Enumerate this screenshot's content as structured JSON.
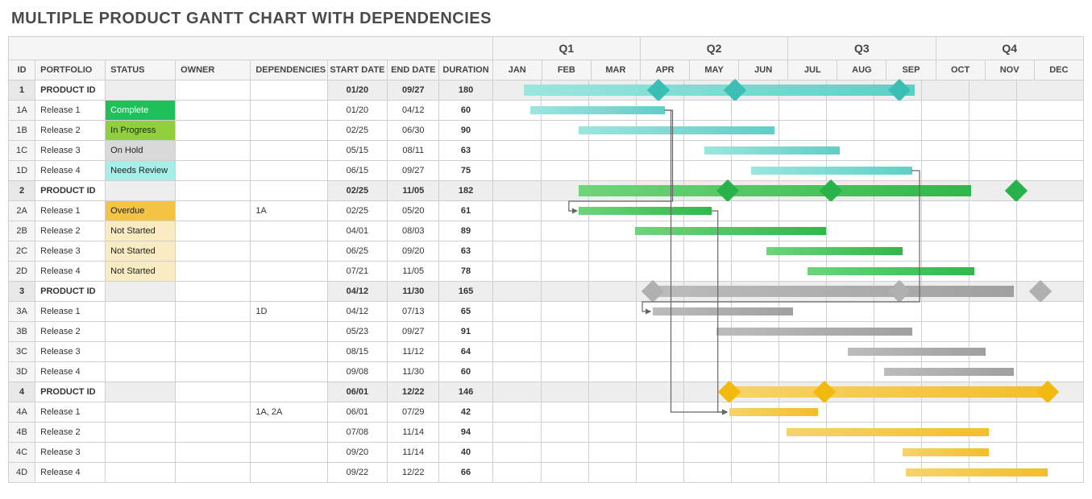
{
  "title": "MULTIPLE PRODUCT GANTT CHART WITH DEPENDENCIES",
  "headers": {
    "id": "ID",
    "portfolio": "PORTFOLIO",
    "status": "STATUS",
    "owner": "OWNER",
    "deps": "DEPENDENCIES",
    "start": "START DATE",
    "end": "END DATE",
    "duration": "DURATION"
  },
  "quarters": [
    "Q1",
    "Q2",
    "Q3",
    "Q4"
  ],
  "months": [
    "JAN",
    "FEB",
    "MAR",
    "APR",
    "MAY",
    "JUN",
    "JUL",
    "AUG",
    "SEP",
    "OCT",
    "NOV",
    "DEC"
  ],
  "status_labels": {
    "complete": "Complete",
    "inprog": "In Progress",
    "onhold": "On Hold",
    "review": "Needs Review",
    "overdue": "Overdue",
    "notstart": "Not Started"
  },
  "rows": [
    {
      "id": "1",
      "product": true,
      "portfolio": "PRODUCT ID",
      "status": "",
      "owner": "",
      "deps": "",
      "start": "01/20",
      "end": "09/27",
      "duration": "180",
      "color": "teal",
      "barStart": 20,
      "barEnd": 270,
      "milestones": [
        106,
        155,
        260
      ]
    },
    {
      "id": "1A",
      "portfolio": "Release 1",
      "status": "complete",
      "owner": "",
      "deps": "",
      "start": "01/20",
      "end": "04/12",
      "duration": "60",
      "color": "teal",
      "barStart": 24,
      "barEnd": 110
    },
    {
      "id": "1B",
      "portfolio": "Release 2",
      "status": "inprog",
      "owner": "",
      "deps": "",
      "start": "02/25",
      "end": "06/30",
      "duration": "90",
      "color": "teal",
      "barStart": 55,
      "barEnd": 180
    },
    {
      "id": "1C",
      "portfolio": "Release 3",
      "status": "onhold",
      "owner": "",
      "deps": "",
      "start": "05/15",
      "end": "08/11",
      "duration": "63",
      "color": "teal",
      "barStart": 135,
      "barEnd": 222
    },
    {
      "id": "1D",
      "portfolio": "Release 4",
      "status": "review",
      "owner": "",
      "deps": "",
      "start": "06/15",
      "end": "09/27",
      "duration": "75",
      "color": "teal",
      "barStart": 165,
      "barEnd": 268
    },
    {
      "id": "2",
      "product": true,
      "portfolio": "PRODUCT ID",
      "status": "",
      "owner": "",
      "deps": "",
      "start": "02/25",
      "end": "11/05",
      "duration": "182",
      "color": "green",
      "barStart": 55,
      "barEnd": 306,
      "milestones": [
        150,
        216,
        335
      ]
    },
    {
      "id": "2A",
      "portfolio": "Release 1",
      "status": "overdue",
      "owner": "",
      "deps": "1A",
      "start": "02/25",
      "end": "05/20",
      "duration": "61",
      "color": "green",
      "barStart": 55,
      "barEnd": 140
    },
    {
      "id": "2B",
      "portfolio": "Release 2",
      "status": "notstart",
      "owner": "",
      "deps": "",
      "start": "04/01",
      "end": "08/03",
      "duration": "89",
      "color": "green",
      "barStart": 91,
      "barEnd": 213
    },
    {
      "id": "2C",
      "portfolio": "Release 3",
      "status": "notstart",
      "owner": "",
      "deps": "",
      "start": "06/25",
      "end": "09/20",
      "duration": "63",
      "color": "green",
      "barStart": 175,
      "barEnd": 262
    },
    {
      "id": "2D",
      "portfolio": "Release 4",
      "status": "notstart",
      "owner": "",
      "deps": "",
      "start": "07/21",
      "end": "11/05",
      "duration": "78",
      "color": "green",
      "barStart": 201,
      "barEnd": 308
    },
    {
      "id": "3",
      "product": true,
      "portfolio": "PRODUCT ID",
      "status": "",
      "owner": "",
      "deps": "",
      "start": "04/12",
      "end": "11/30",
      "duration": "165",
      "color": "grey",
      "barStart": 102,
      "barEnd": 333,
      "milestones": [
        102,
        260,
        350
      ]
    },
    {
      "id": "3A",
      "portfolio": "Release 1",
      "status": "",
      "owner": "",
      "deps": "1D",
      "start": "04/12",
      "end": "07/13",
      "duration": "65",
      "color": "grey",
      "barStart": 102,
      "barEnd": 192
    },
    {
      "id": "3B",
      "portfolio": "Release 2",
      "status": "",
      "owner": "",
      "deps": "",
      "start": "05/23",
      "end": "09/27",
      "duration": "91",
      "color": "grey",
      "barStart": 143,
      "barEnd": 268
    },
    {
      "id": "3C",
      "portfolio": "Release 3",
      "status": "",
      "owner": "",
      "deps": "",
      "start": "08/15",
      "end": "11/12",
      "duration": "64",
      "color": "grey",
      "barStart": 227,
      "barEnd": 315
    },
    {
      "id": "3D",
      "portfolio": "Release 4",
      "status": "",
      "owner": "",
      "deps": "",
      "start": "09/08",
      "end": "11/30",
      "duration": "60",
      "color": "grey",
      "barStart": 250,
      "barEnd": 333
    },
    {
      "id": "4",
      "product": true,
      "portfolio": "PRODUCT ID",
      "status": "",
      "owner": "",
      "deps": "",
      "start": "06/01",
      "end": "12/22",
      "duration": "146",
      "color": "gold",
      "barStart": 151,
      "barEnd": 355,
      "milestones": [
        151,
        212,
        355
      ]
    },
    {
      "id": "4A",
      "portfolio": "Release 1",
      "status": "",
      "owner": "",
      "deps": "1A, 2A",
      "start": "06/01",
      "end": "07/29",
      "duration": "42",
      "color": "gold",
      "barStart": 151,
      "barEnd": 208
    },
    {
      "id": "4B",
      "portfolio": "Release 2",
      "status": "",
      "owner": "",
      "deps": "",
      "start": "07/08",
      "end": "11/14",
      "duration": "94",
      "color": "gold",
      "barStart": 188,
      "barEnd": 317
    },
    {
      "id": "4C",
      "portfolio": "Release 3",
      "status": "",
      "owner": "",
      "deps": "",
      "start": "09/20",
      "end": "11/14",
      "duration": "40",
      "color": "gold",
      "barStart": 262,
      "barEnd": 317
    },
    {
      "id": "4D",
      "portfolio": "Release 4",
      "status": "",
      "owner": "",
      "deps": "",
      "start": "09/22",
      "end": "12/22",
      "duration": "66",
      "color": "gold",
      "barStart": 264,
      "barEnd": 355
    }
  ],
  "dep_arrows": [
    {
      "from": "1A",
      "to": "2A"
    },
    {
      "from": "1D",
      "to": "3A"
    },
    {
      "from": "1A",
      "to": "4A"
    },
    {
      "from": "2A",
      "to": "4A"
    }
  ],
  "chart_data": {
    "type": "gantt",
    "title": "MULTIPLE PRODUCT GANTT CHART WITH DEPENDENCIES",
    "x_axis": {
      "months": [
        "JAN",
        "FEB",
        "MAR",
        "APR",
        "MAY",
        "JUN",
        "JUL",
        "AUG",
        "SEP",
        "OCT",
        "NOV",
        "DEC"
      ],
      "quarters": [
        "Q1",
        "Q2",
        "Q3",
        "Q4"
      ]
    },
    "products": [
      {
        "id": "1",
        "name": "PRODUCT ID",
        "start": "01/20",
        "end": "09/27",
        "duration": 180,
        "color": "teal",
        "tasks": [
          {
            "id": "1A",
            "name": "Release 1",
            "status": "Complete",
            "start": "01/20",
            "end": "04/12",
            "duration": 60
          },
          {
            "id": "1B",
            "name": "Release 2",
            "status": "In Progress",
            "start": "02/25",
            "end": "06/30",
            "duration": 90
          },
          {
            "id": "1C",
            "name": "Release 3",
            "status": "On Hold",
            "start": "05/15",
            "end": "08/11",
            "duration": 63
          },
          {
            "id": "1D",
            "name": "Release 4",
            "status": "Needs Review",
            "start": "06/15",
            "end": "09/27",
            "duration": 75
          }
        ]
      },
      {
        "id": "2",
        "name": "PRODUCT ID",
        "start": "02/25",
        "end": "11/05",
        "duration": 182,
        "color": "green",
        "tasks": [
          {
            "id": "2A",
            "name": "Release 1",
            "status": "Overdue",
            "deps": "1A",
            "start": "02/25",
            "end": "05/20",
            "duration": 61
          },
          {
            "id": "2B",
            "name": "Release 2",
            "status": "Not Started",
            "start": "04/01",
            "end": "08/03",
            "duration": 89
          },
          {
            "id": "2C",
            "name": "Release 3",
            "status": "Not Started",
            "start": "06/25",
            "end": "09/20",
            "duration": 63
          },
          {
            "id": "2D",
            "name": "Release 4",
            "status": "Not Started",
            "start": "07/21",
            "end": "11/05",
            "duration": 78
          }
        ]
      },
      {
        "id": "3",
        "name": "PRODUCT ID",
        "start": "04/12",
        "end": "11/30",
        "duration": 165,
        "color": "grey",
        "tasks": [
          {
            "id": "3A",
            "name": "Release 1",
            "deps": "1D",
            "start": "04/12",
            "end": "07/13",
            "duration": 65
          },
          {
            "id": "3B",
            "name": "Release 2",
            "start": "05/23",
            "end": "09/27",
            "duration": 91
          },
          {
            "id": "3C",
            "name": "Release 3",
            "start": "08/15",
            "end": "11/12",
            "duration": 64
          },
          {
            "id": "3D",
            "name": "Release 4",
            "start": "09/08",
            "end": "11/30",
            "duration": 60
          }
        ]
      },
      {
        "id": "4",
        "name": "PRODUCT ID",
        "start": "06/01",
        "end": "12/22",
        "duration": 146,
        "color": "gold",
        "tasks": [
          {
            "id": "4A",
            "name": "Release 1",
            "deps": "1A, 2A",
            "start": "06/01",
            "end": "07/29",
            "duration": 42
          },
          {
            "id": "4B",
            "name": "Release 2",
            "start": "07/08",
            "end": "11/14",
            "duration": 94
          },
          {
            "id": "4C",
            "name": "Release 3",
            "start": "09/20",
            "end": "11/14",
            "duration": 40
          },
          {
            "id": "4D",
            "name": "Release 4",
            "start": "09/22",
            "end": "12/22",
            "duration": 66
          }
        ]
      }
    ],
    "dependencies": [
      {
        "from": "1A",
        "to": "2A"
      },
      {
        "from": "1D",
        "to": "3A"
      },
      {
        "from": "1A",
        "to": "4A"
      },
      {
        "from": "2A",
        "to": "4A"
      }
    ]
  }
}
